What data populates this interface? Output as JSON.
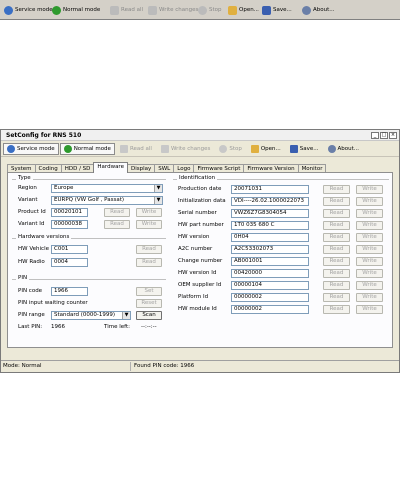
{
  "background_toolbar": {
    "items": [
      {
        "label": "Service mode",
        "state": "normal"
      },
      {
        "label": "Normal mode",
        "state": "normal"
      },
      {
        "label": "Read all",
        "state": "disabled"
      },
      {
        "label": "Write changes",
        "state": "disabled"
      },
      {
        "label": "Stop",
        "state": "disabled"
      },
      {
        "label": "Open...",
        "state": "normal"
      },
      {
        "label": "Save...",
        "state": "normal"
      },
      {
        "label": "About...",
        "state": "normal"
      }
    ]
  },
  "window": {
    "title": "SetConfig for RNS 510",
    "controls": {
      "minimize": "_",
      "maximize": "□",
      "close": "×"
    }
  },
  "toolbar": {
    "service_mode": "Service mode",
    "normal_mode": "Normal mode",
    "read_all": "Read all",
    "write_changes": "Write changes",
    "stop": "Stop",
    "open": "Open...",
    "save": "Save...",
    "about": "About..."
  },
  "tabs": [
    "System",
    "Coding",
    "HDD / SD",
    "Hardware",
    "Display",
    "SWL",
    "Logo",
    "Firmware Script",
    "Firmware Version",
    "Monitor"
  ],
  "active_tab": "Hardware",
  "type_group": {
    "title": "Type",
    "region_label": "Region",
    "region_value": "Europe",
    "variant_label": "Variant",
    "variant_value": "EURPQ (VW Golf , Passat)",
    "product_id_label": "Product Id",
    "product_id_value": "00020101",
    "variant_id_label": "Variant Id",
    "variant_id_value": "00000038",
    "read_label": "Read",
    "write_label": "Write"
  },
  "hw_versions": {
    "title": "Hardware versions",
    "hw_vehicle_label": "HW Vehicle",
    "hw_vehicle_value": "C001",
    "hw_radio_label": "HW Radio",
    "hw_radio_value": "0004",
    "read_label": "Read"
  },
  "pin_group": {
    "title": "PIN",
    "pin_code_label": "PIN code",
    "pin_code_value": "1966",
    "set_label": "Set",
    "waiting_label": "PIN input waiting counter",
    "reset_label": "Reset",
    "range_label": "PIN range",
    "range_value": "Standard (0000-1999)",
    "scan_label": "Scan",
    "last_pin_label": "Last PIN:",
    "last_pin_value": "1966",
    "time_left_label": "Time left:",
    "time_left_value": "--:--:--"
  },
  "identification": {
    "title": "Identification",
    "read_label": "Read",
    "write_label": "Write",
    "rows": [
      {
        "label": "Production date",
        "value": "20071031"
      },
      {
        "label": "Initialization data",
        "value": "VDI----26.02.1000022073"
      },
      {
        "label": "Serial number",
        "value": "VWZ6Z7G8304054"
      },
      {
        "label": "HW part number",
        "value": "1T0 035 680 C"
      },
      {
        "label": "HW version",
        "value": "0H04"
      },
      {
        "label": "A2C number",
        "value": "A2C53302073"
      },
      {
        "label": "Change number",
        "value": "AB001001"
      },
      {
        "label": "HW version Id",
        "value": "00420000"
      },
      {
        "label": "OEM supplier Id",
        "value": "00000104"
      },
      {
        "label": "Platform Id",
        "value": "00000002"
      },
      {
        "label": "HW module Id",
        "value": "00000002"
      }
    ]
  },
  "status": {
    "mode": "Mode: Normal",
    "message": "Found PIN code: 1966"
  },
  "colors": {
    "window_bg": "#ece9d8",
    "panel_bg": "#fcfcfe",
    "service_icon": "#3a6fc4",
    "normal_icon": "#2e9a2e",
    "open_icon": "#e0b040",
    "save_icon": "#3a5fb0",
    "about_icon": "#6a7fa8"
  }
}
